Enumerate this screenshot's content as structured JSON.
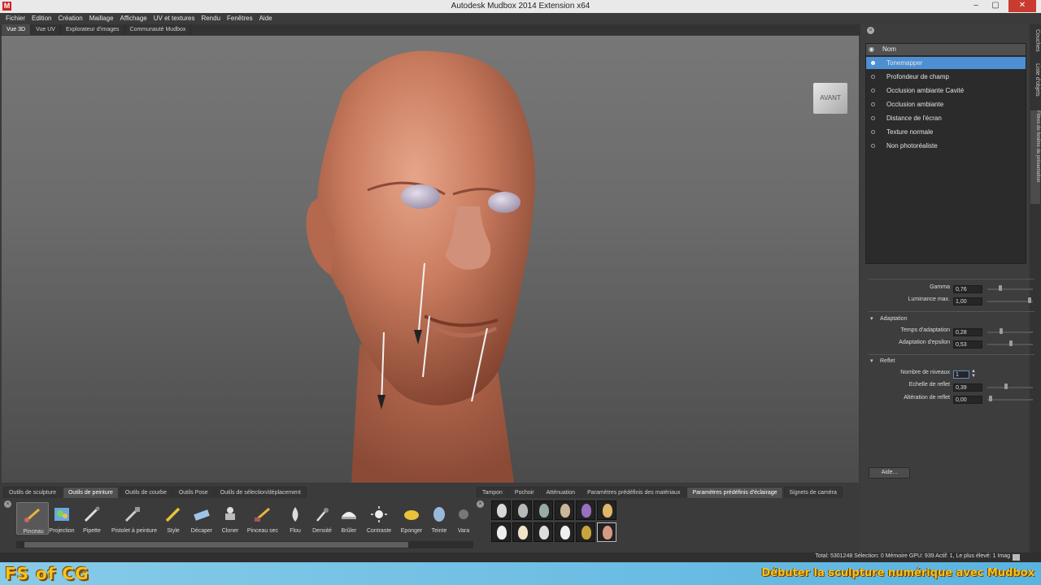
{
  "window": {
    "title": "Autodesk Mudbox 2014 Extension x64"
  },
  "menu": [
    "Fichier",
    "Edition",
    "Création",
    "Maillage",
    "Affichage",
    "UV et textures",
    "Rendu",
    "Fenêtres",
    "Aide"
  ],
  "view_tabs": [
    "Vue 3D",
    "Vue UV",
    "Explorateur d'images",
    "Communauté Mudbox"
  ],
  "viewcube": {
    "label": "AVANT"
  },
  "filters": {
    "header": "Nom",
    "items": [
      "Tonemapper",
      "Profondeur de champ",
      "Occlusion ambiante Cavité",
      "Occlusion ambiante",
      "Distance de l'écran",
      "Texture normale",
      "Non photoréaliste"
    ],
    "selected": "Tonemapper"
  },
  "side_tabs": [
    "Couches",
    "Liste d'objets",
    "Filtres de fenêtre de présentation"
  ],
  "properties": {
    "gamma": {
      "label": "Gamma",
      "value": "0,76"
    },
    "luminance": {
      "label": "Luminance max.",
      "value": "1,00"
    },
    "adaptation": {
      "title": "Adaptation",
      "temps": {
        "label": "Temps d'adaptation",
        "value": "0,28"
      },
      "epsilon": {
        "label": "Adaptation d'epsilon",
        "value": "0,53"
      }
    },
    "reflet": {
      "title": "Reflet",
      "niveaux": {
        "label": "Nombre de niveaux",
        "value": "1"
      },
      "echelle": {
        "label": "Echelle de reflet",
        "value": "0,39"
      },
      "alteration": {
        "label": "Altération de reflet",
        "value": "0,00"
      }
    },
    "help_label": "Aide..."
  },
  "tray": {
    "left_tabs": [
      "Outils de sculpture",
      "Outils de peinture",
      "Outils de courbe",
      "Outils Pose",
      "Outils de sélection/déplacement"
    ],
    "left_active": "Outils de peinture",
    "tools": [
      "Pinceau",
      "Projection",
      "Pipette",
      "Pistolet à peinture",
      "Style",
      "Décaper",
      "Cloner",
      "Pinceau sec",
      "Flou",
      "Densité",
      "Brûler",
      "Contraste",
      "Eponger",
      "Teinte",
      "Vara"
    ],
    "right_tabs": [
      "Tampon",
      "Pochoir",
      "Atténuation",
      "Paramètres prédéfinis des matériaux",
      "Paramètres prédéfinis d'éclairage",
      "Signets de caméra"
    ],
    "right_active": "Paramètres prédéfinis d'éclairage"
  },
  "status": {
    "text": "Total: 5301248  Sélection: 0  Mémoire GPU: 939  Actif: 1, Le plus élevé: 1  Imag"
  },
  "overlay": {
    "logo": "FS of CG",
    "tagline": "Débuter la sculpture numérique avec Mudbox"
  },
  "colors": {
    "selection": "#4d8fd3",
    "close_button": "#c83b2e",
    "banner": "#59b3e0",
    "logo": "#f6c21e"
  }
}
